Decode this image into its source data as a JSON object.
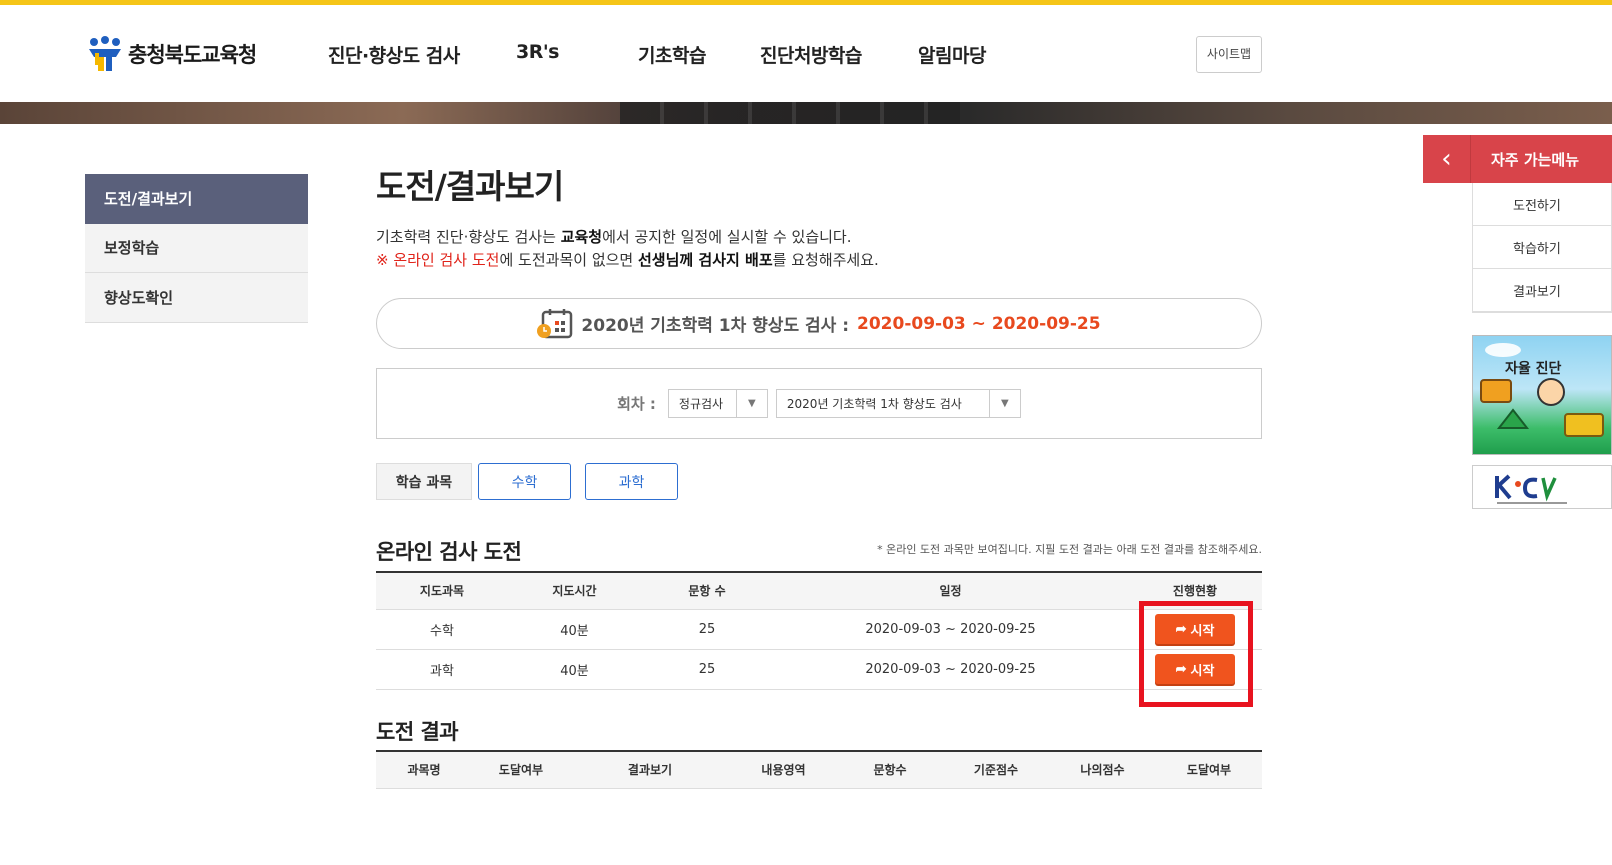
{
  "header": {
    "logo_text": "충청북도교육청",
    "nav": [
      "진단·향상도 검사",
      "3R's",
      "기초학습",
      "진단처방학습",
      "알림마당"
    ],
    "sitemap_label": "사이트맵"
  },
  "sidebar": {
    "items": [
      {
        "label": "도전/결과보기",
        "active": true
      },
      {
        "label": "보정학습",
        "active": false
      },
      {
        "label": "향상도확인",
        "active": false
      }
    ]
  },
  "main": {
    "title": "도전/결과보기",
    "desc1_pre": "기초학력 진단·향상도 검사는 ",
    "desc1_bold": "교육청",
    "desc1_post": "에서 공지한 일정에 실시할 수 있습니다.",
    "desc2_red": "※ 온라인 검사 도전",
    "desc2_mid": "에 도전과목이 없으면 ",
    "desc2_bold": "선생님께 검사지 배포",
    "desc2_post": "를 요청해주세요.",
    "schedule_label": "2020년 기초학력 1차 향상도 검사 :",
    "schedule_dates": "2020-09-03 ~ 2020-09-25",
    "round_label": "회차 :",
    "round_select1": "정규검사",
    "round_select2": "2020년 기초학력 1차 향상도 검사",
    "subject_label": "학습 과목",
    "subject_buttons": [
      "수학",
      "과학"
    ]
  },
  "online": {
    "title": "온라인 검사 도전",
    "note": "* 온라인 도전 과목만 보여집니다. 지필 도전 결과는 아래 도전 결과를 참조해주세요.",
    "headers": [
      "지도과목",
      "지도시간",
      "문항 수",
      "일정",
      "진행현황"
    ],
    "rows": [
      {
        "subject": "수학",
        "time": "40분",
        "count": "25",
        "period": "2020-09-03 ~ 2020-09-25",
        "action": "시작"
      },
      {
        "subject": "과학",
        "time": "40분",
        "count": "25",
        "period": "2020-09-03 ~ 2020-09-25",
        "action": "시작"
      }
    ]
  },
  "result": {
    "title": "도전 결과",
    "headers": [
      "과목명",
      "도달여부",
      "결과보기",
      "내용영역",
      "문항수",
      "기준점수",
      "나의점수",
      "도달여부"
    ]
  },
  "quick": {
    "title": "자주 가는메뉴",
    "items": [
      "도전하기",
      "학습하기",
      "결과보기"
    ],
    "banner1_text": "자율 진단"
  },
  "colors": {
    "accent_orange": "#f0541e",
    "top_bar": "#f5c518",
    "sidebar_active": "#5a607b",
    "quick_red": "#d8444a",
    "link_blue": "#2d6ed1",
    "highlight_red": "#e8131f"
  }
}
